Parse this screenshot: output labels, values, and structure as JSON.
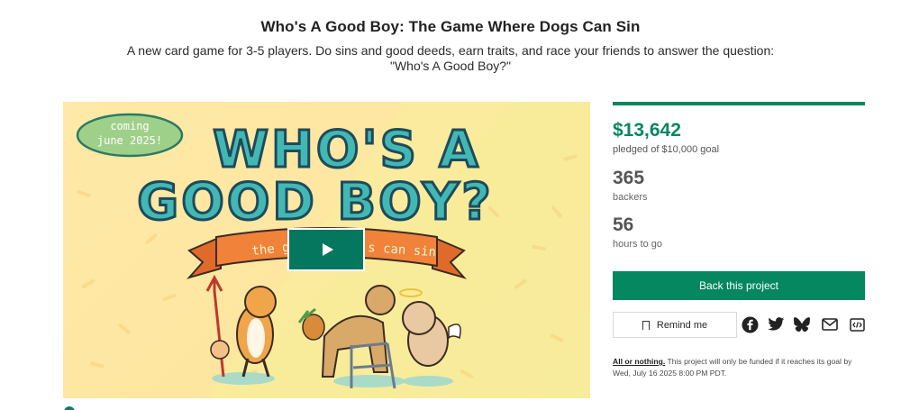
{
  "project": {
    "title": "Who's A Good Boy: The Game Where Dogs Can Sin",
    "blurb": "A new card game for 3-5 players. Do sins and good deeds, earn traits, and race your friends to answer the question: \"Who's A Good Boy?\""
  },
  "media": {
    "badge_line1": "coming",
    "badge_line2": "june 2025!",
    "title_line1": "WHO'S A",
    "title_line2": "GOOD BOY?",
    "ribbon_left": "the gam",
    "ribbon_right": "s can sin",
    "play_label": "play-icon"
  },
  "stats": {
    "progress_fraction": 1.0,
    "pledged": "$13,642",
    "pledged_label": "pledged of $10,000 goal",
    "backers": "365",
    "backers_label": "backers",
    "hours": "56",
    "hours_label": "hours to go"
  },
  "actions": {
    "back_label": "Back this project",
    "remind_label": "Remind me",
    "share_icons": [
      "facebook-icon",
      "twitter-icon",
      "bluesky-icon",
      "email-icon",
      "embed-icon"
    ]
  },
  "fine_print": {
    "lead": "All or nothing.",
    "text": " This project will only be funded if it reaches its goal by Wed, July 16 2025 8:00 PM PDT."
  },
  "colors": {
    "accent": "#05875f",
    "play_button": "#06775f",
    "title_teal": "#3db7b5",
    "ribbon": "#f0823a",
    "badge": "#9fd08a"
  }
}
